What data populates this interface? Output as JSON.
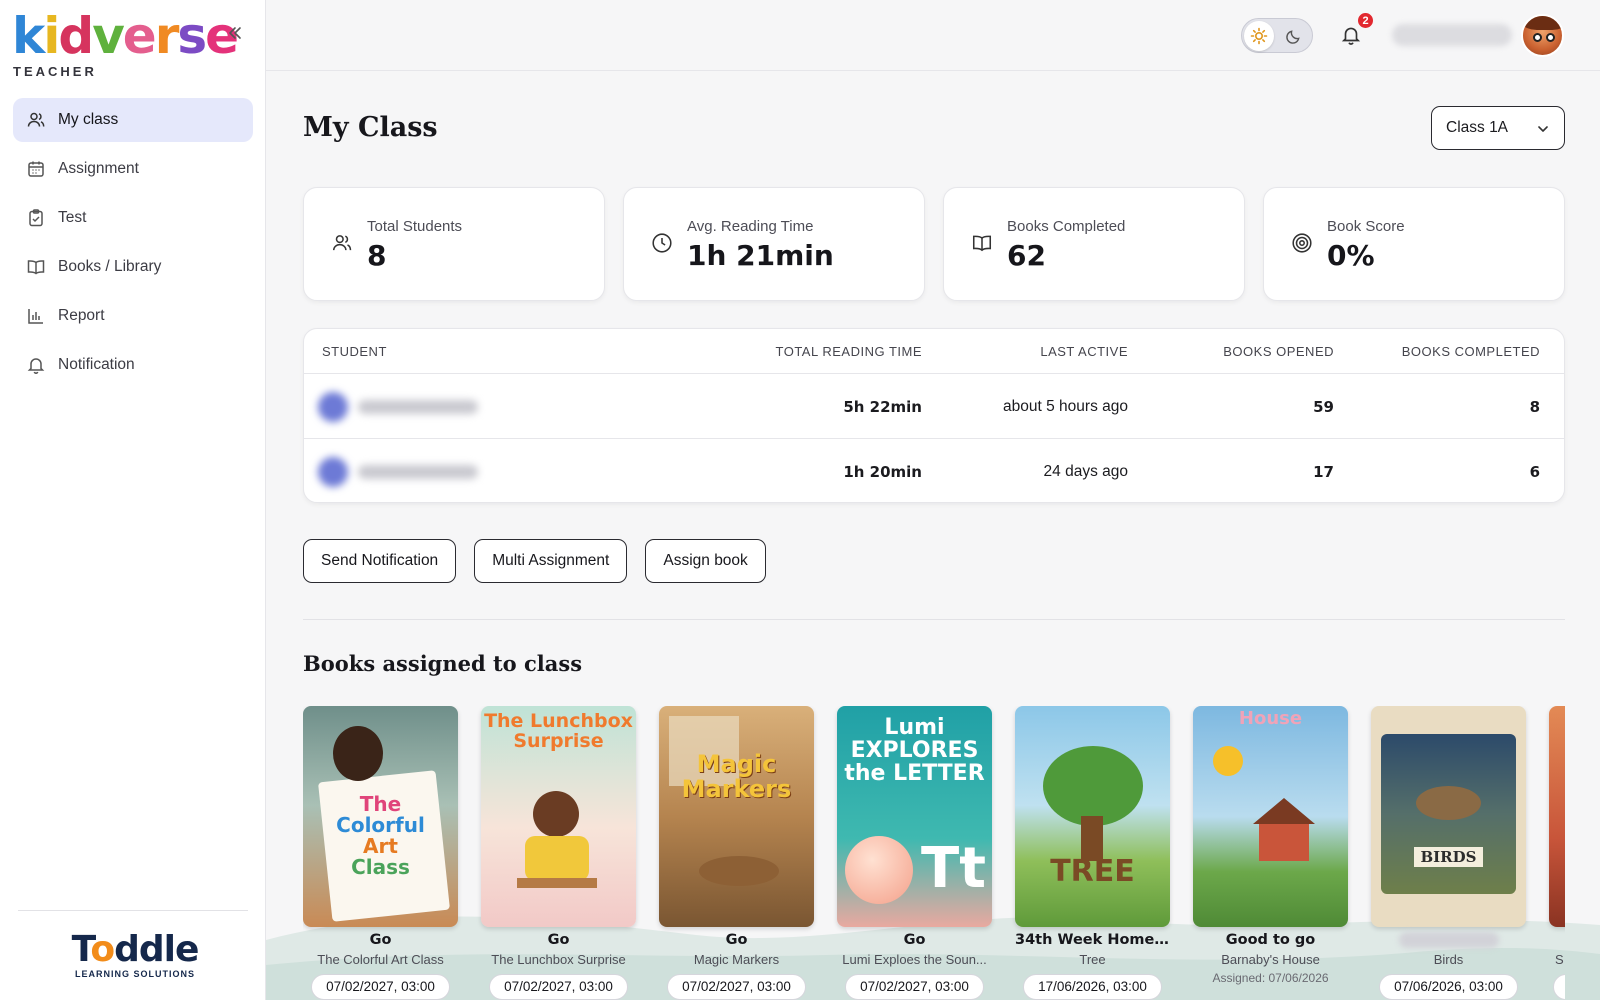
{
  "brand": {
    "logo_text": "kidverse",
    "logo_sub": "TEACHER",
    "footer_logo": "Toddle",
    "footer_sub": "LEARNING SOLUTIONS"
  },
  "sidebar": {
    "items": [
      {
        "label": "My class",
        "icon": "users-icon",
        "active": true
      },
      {
        "label": "Assignment",
        "icon": "calendar-icon",
        "active": false
      },
      {
        "label": "Test",
        "icon": "clipboard-check-icon",
        "active": false
      },
      {
        "label": "Books / Library",
        "icon": "book-open-icon",
        "active": false
      },
      {
        "label": "Report",
        "icon": "bar-chart-icon",
        "active": false
      },
      {
        "label": "Notification",
        "icon": "bell-icon",
        "active": false
      }
    ]
  },
  "topbar": {
    "notification_count": "2",
    "theme": "light"
  },
  "page": {
    "title": "My Class",
    "class_select": "Class 1A"
  },
  "stats": [
    {
      "label": "Total Students",
      "value": "8",
      "icon": "users-icon"
    },
    {
      "label": "Avg. Reading Time",
      "value": "1h 21min",
      "icon": "clock-icon"
    },
    {
      "label": "Books Completed",
      "value": "62",
      "icon": "book-open-icon"
    },
    {
      "label": "Book Score",
      "value": "0%",
      "icon": "target-icon"
    }
  ],
  "table": {
    "headers": [
      "STUDENT",
      "TOTAL READING TIME",
      "LAST ACTIVE",
      "BOOKS OPENED",
      "BOOKS COMPLETED"
    ],
    "rows": [
      {
        "reading_time": "5h 22min",
        "last_active": "about 5 hours ago",
        "opened": "59",
        "completed": "8"
      },
      {
        "reading_time": "1h 20min",
        "last_active": "24 days ago",
        "opened": "17",
        "completed": "6"
      }
    ]
  },
  "actions": [
    "Send Notification",
    "Multi Assignment",
    "Assign book"
  ],
  "books_section": {
    "title": "Books assigned to class",
    "books": [
      {
        "title": "Go",
        "subtitle": "The Colorful Art Class",
        "date": "07/02/2027, 03:00",
        "cover_text": "The Colorful Art Class",
        "cover_color": "#c98a55"
      },
      {
        "title": "Go",
        "subtitle": "The Lunchbox Surprise",
        "date": "07/02/2027, 03:00",
        "cover_text": "The Lunchbox Surprise",
        "cover_color": "#f2c9c7"
      },
      {
        "title": "Go",
        "subtitle": "Magic Markers",
        "date": "07/02/2027, 03:00",
        "cover_text": "Magic Markers",
        "cover_color": "#b5844f"
      },
      {
        "title": "Go",
        "subtitle": "Lumi Exploes the Soun...",
        "date": "07/02/2027, 03:00",
        "cover_text": "Lumi EXPLORES the LETTER Tt",
        "cover_color": "#2aa6a2"
      },
      {
        "title": "34th Week Homew...",
        "subtitle": "Tree",
        "date": "17/06/2026, 03:00",
        "cover_text": "TREE",
        "cover_color": "#8cc7e8"
      },
      {
        "title": "Good to go",
        "subtitle": "Barnaby's House",
        "assigned": "Assigned: 07/06/2026",
        "cover_text": "House",
        "cover_color": "#7db8e0"
      },
      {
        "title": "",
        "subtitle": "Birds",
        "date": "07/06/2026, 03:00",
        "cover_text": "BIRDS",
        "cover_color": "#e9dcc2"
      },
      {
        "title": "",
        "subtitle": "S",
        "date": "",
        "cover_text": "",
        "cover_color": "#c8553a"
      }
    ]
  }
}
